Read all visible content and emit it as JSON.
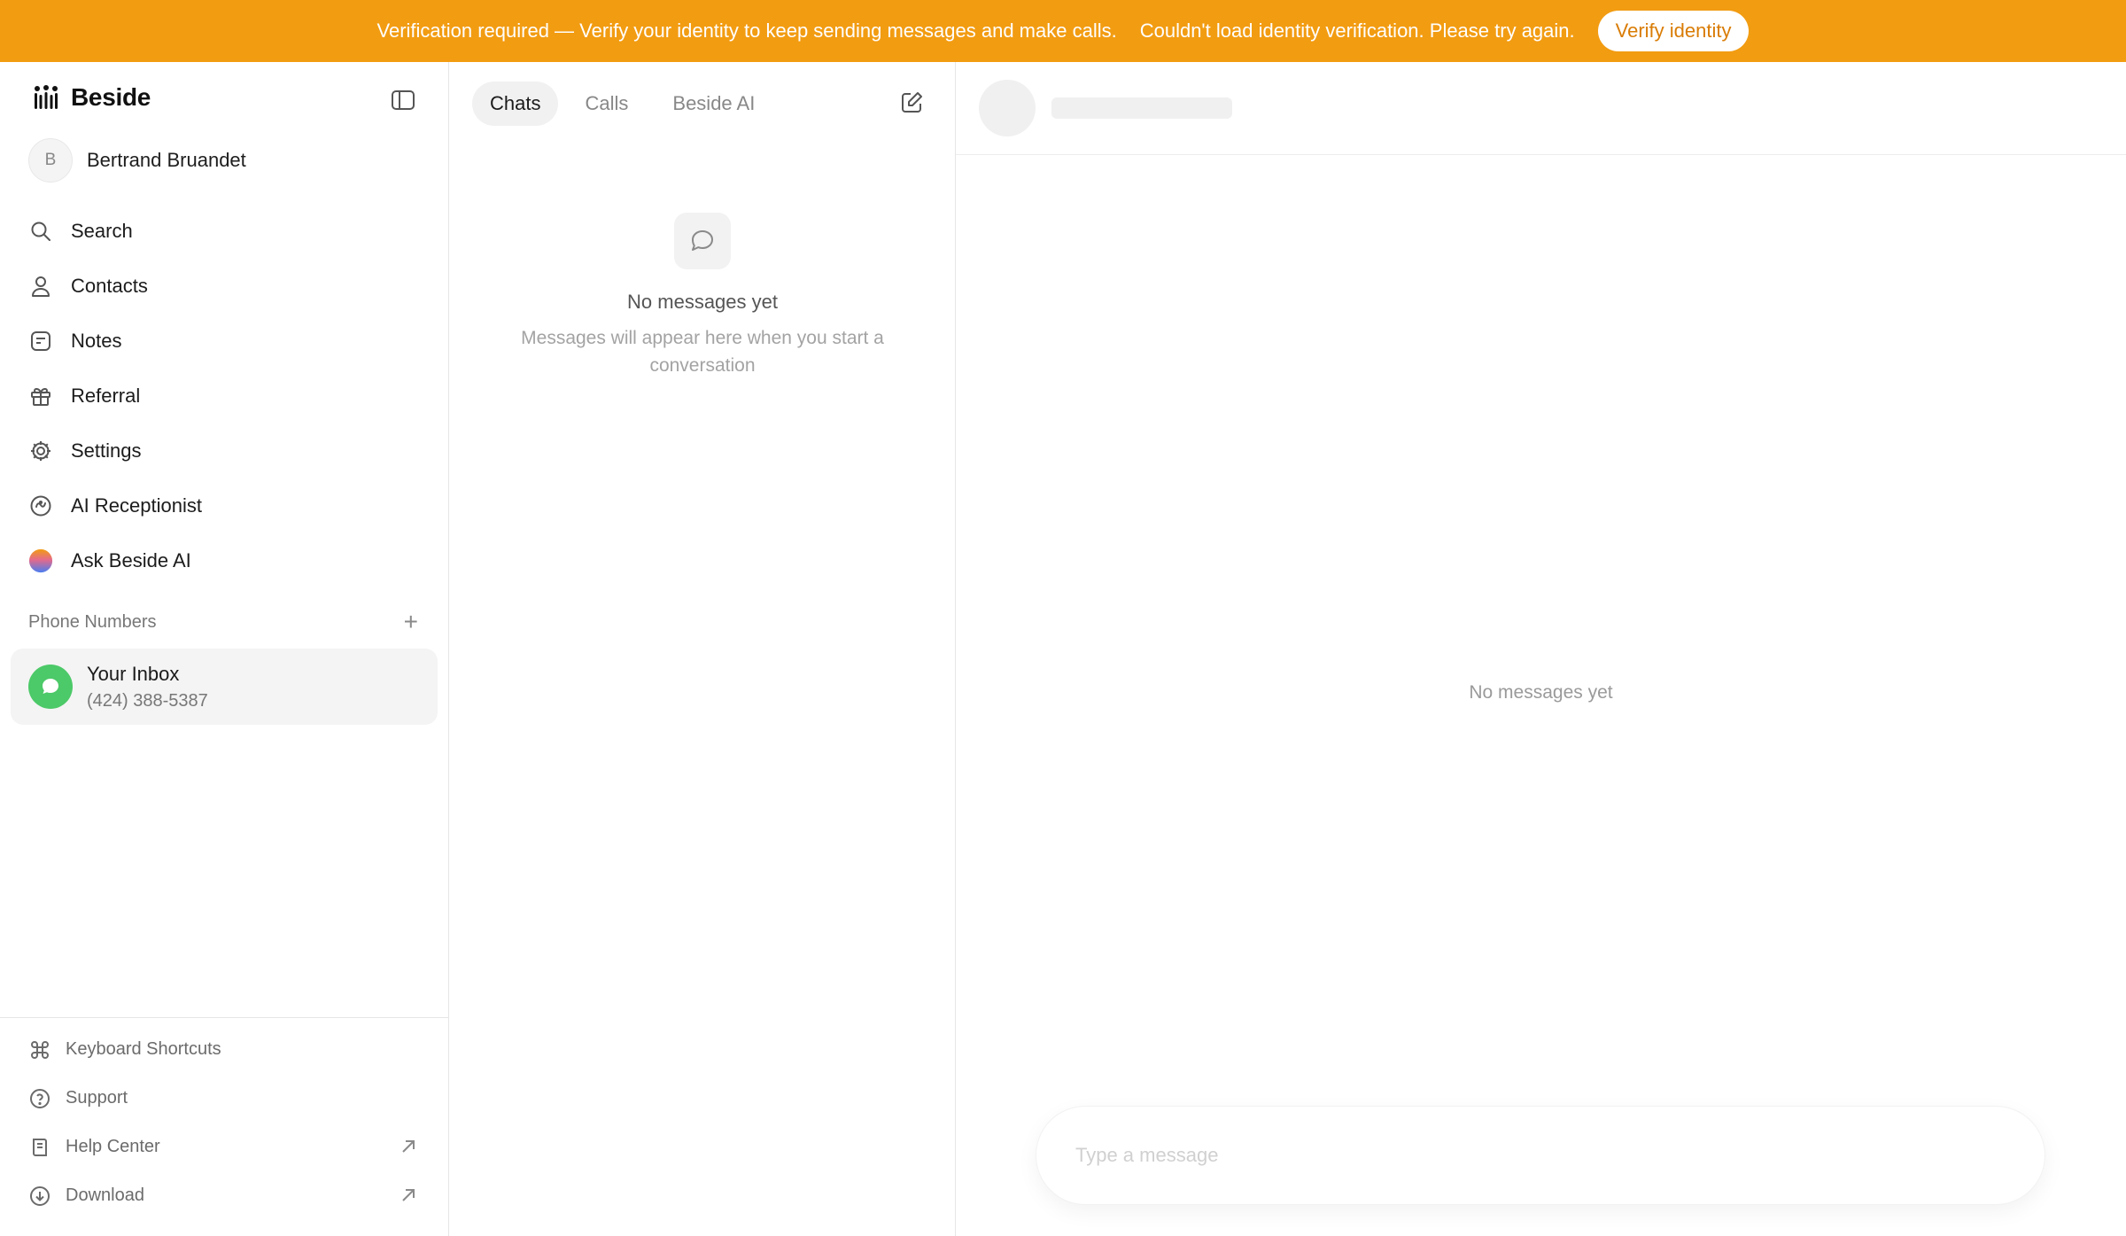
{
  "banner": {
    "message": "Verification required — Verify your identity to keep sending messages and make calls.",
    "error": "Couldn't load identity verification. Please try again.",
    "button": "Verify identity",
    "color": "#f29c12"
  },
  "sidebar": {
    "brand": "Beside",
    "user": {
      "initial": "B",
      "name": "Bertrand Bruandet"
    },
    "nav": [
      {
        "label": "Search",
        "icon": "search-icon"
      },
      {
        "label": "Contacts",
        "icon": "person-icon"
      },
      {
        "label": "Notes",
        "icon": "note-icon"
      },
      {
        "label": "Referral",
        "icon": "gift-icon"
      },
      {
        "label": "Settings",
        "icon": "gear-icon"
      },
      {
        "label": "AI Receptionist",
        "icon": "receptionist-icon"
      },
      {
        "label": "Ask Beside AI",
        "icon": "gradient-orb-icon"
      }
    ],
    "phone_section": {
      "title": "Phone Numbers",
      "add": "+"
    },
    "inbox": {
      "title": "Your Inbox",
      "number": "(424) 388-5387",
      "color": "#4cc968"
    },
    "bottom": [
      {
        "label": "Keyboard Shortcuts",
        "icon": "command-icon"
      },
      {
        "label": "Support",
        "icon": "help-circle-icon"
      },
      {
        "label": "Help Center",
        "icon": "book-icon",
        "external": true
      },
      {
        "label": "Download",
        "icon": "download-icon",
        "external": true
      }
    ]
  },
  "middle": {
    "tabs": [
      {
        "label": "Chats",
        "active": true
      },
      {
        "label": "Calls",
        "active": false
      },
      {
        "label": "Beside AI",
        "active": false
      }
    ],
    "empty": {
      "title": "No messages yet",
      "subtitle": "Messages will appear here when you start a conversation"
    }
  },
  "conversation": {
    "empty_text": "No messages yet",
    "composer_placeholder": "Type a message"
  }
}
